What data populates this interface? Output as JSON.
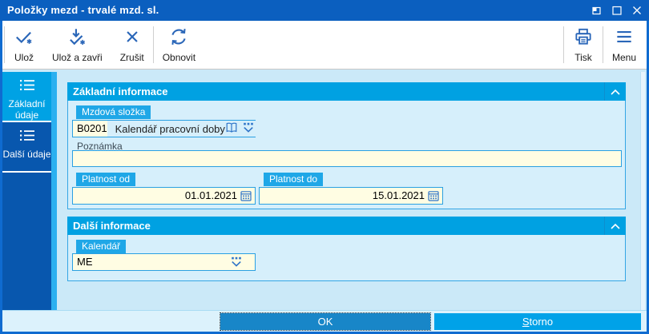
{
  "window": {
    "title": "Položky mezd - trvalé mzd. sl."
  },
  "toolbar": {
    "save": "Ulož",
    "save_close": "Ulož a zavři",
    "cancel": "Zrušit",
    "refresh": "Obnovit",
    "print": "Tisk",
    "menu": "Menu"
  },
  "sidebar": {
    "items": [
      {
        "label": "Základní údaje",
        "active": true
      },
      {
        "label": "Další údaje",
        "active": false
      }
    ]
  },
  "sections": {
    "basic": {
      "title": "Základní informace"
    },
    "other": {
      "title": "Další informace"
    }
  },
  "fields": {
    "wage_component": {
      "label": "Mzdová složka",
      "code": "B0201",
      "description": "Kalendář pracovní doby"
    },
    "note": {
      "label": "Poznámka",
      "value": ""
    },
    "valid_from": {
      "label": "Platnost od",
      "value": "01.01.2021"
    },
    "valid_to": {
      "label": "Platnost do",
      "value": "15.01.2021"
    },
    "calendar": {
      "label": "Kalendář",
      "value": "ME"
    }
  },
  "footer": {
    "ok": "OK",
    "storno_accel": "S",
    "storno_rest": "torno"
  },
  "colors": {
    "titlebar": "#0B5FBF",
    "sidebar": "#0857AE",
    "accent": "#00A2E4",
    "section_header": "#00A1E2",
    "input_bg": "#FFFDE3",
    "input_border": "#2AA0E2"
  }
}
